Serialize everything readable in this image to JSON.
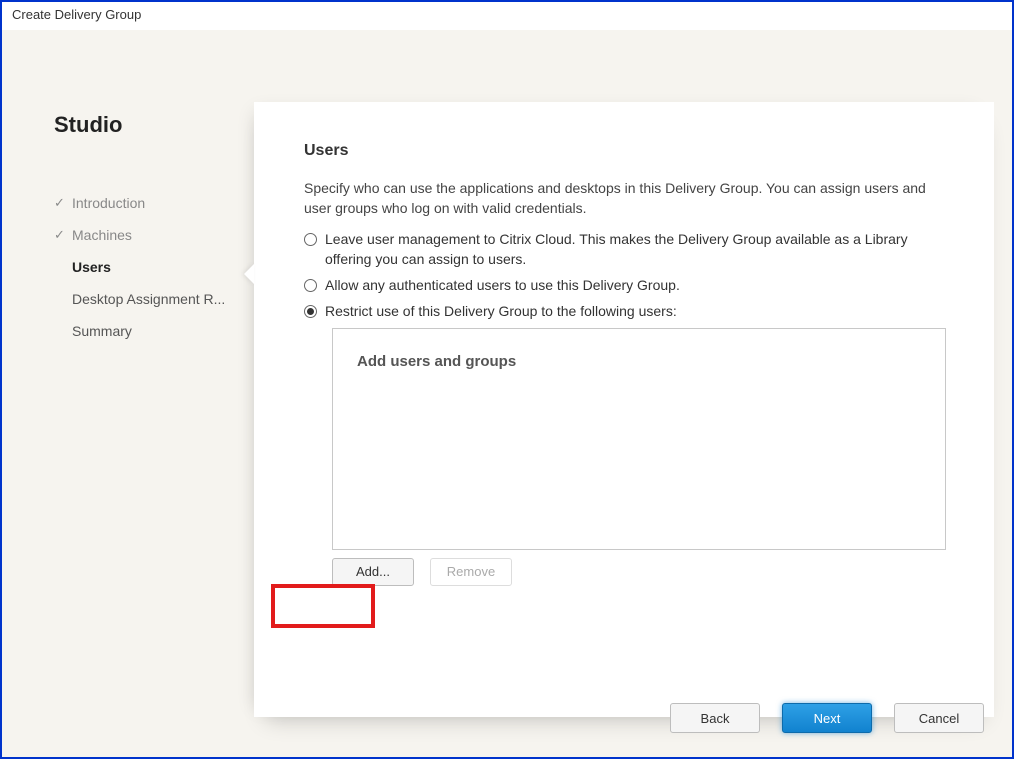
{
  "window": {
    "title": "Create Delivery Group"
  },
  "sidebar": {
    "app_name": "Studio",
    "steps": [
      {
        "label": "Introduction",
        "state": "done"
      },
      {
        "label": "Machines",
        "state": "done"
      },
      {
        "label": "Users",
        "state": "active"
      },
      {
        "label": "Desktop Assignment R...",
        "state": "pending"
      },
      {
        "label": "Summary",
        "state": "pending"
      }
    ]
  },
  "main": {
    "heading": "Users",
    "description": "Specify who can use the applications and desktops in this Delivery Group. You can assign users and user groups who log on with valid credentials.",
    "options": [
      {
        "label": "Leave user management to Citrix Cloud. This makes the Delivery Group available as a Library offering you can assign to users.",
        "selected": false
      },
      {
        "label": "Allow any authenticated users to use this Delivery Group.",
        "selected": false
      },
      {
        "label": "Restrict use of this Delivery Group to the following users:",
        "selected": true
      }
    ],
    "users_box_placeholder": "Add users and groups",
    "add_button": "Add...",
    "remove_button": "Remove"
  },
  "footer": {
    "back": "Back",
    "next": "Next",
    "cancel": "Cancel"
  }
}
